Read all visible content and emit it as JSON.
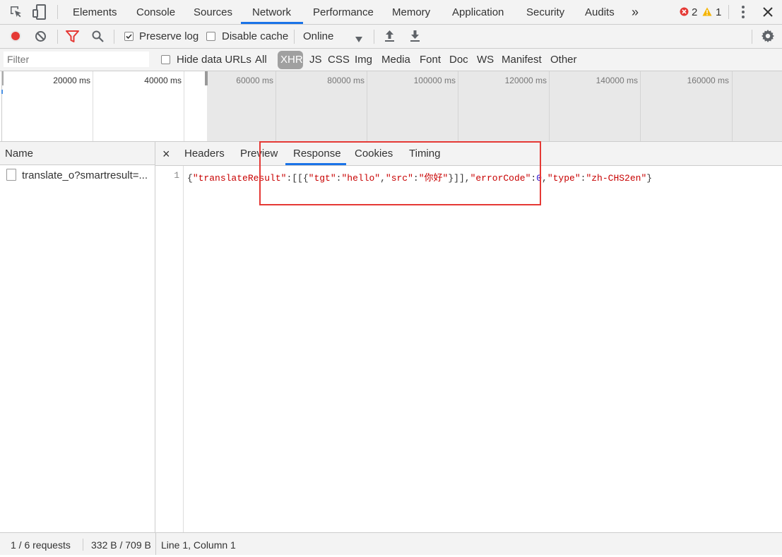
{
  "tabs": {
    "items": [
      "Elements",
      "Console",
      "Sources",
      "Network",
      "Performance",
      "Memory",
      "Application",
      "Security",
      "Audits"
    ],
    "active": "Network",
    "more": "»",
    "errors": "2",
    "warnings": "1"
  },
  "toolbar": {
    "preserve_log": "Preserve log",
    "preserve_log_checked": true,
    "disable_cache": "Disable cache",
    "disable_cache_checked": false,
    "throttle": "Online"
  },
  "filterbar": {
    "placeholder": "Filter",
    "hide_data_urls": "Hide data URLs",
    "types": [
      "All",
      "XHR",
      "JS",
      "CSS",
      "Img",
      "Media",
      "Font",
      "Doc",
      "WS",
      "Manifest",
      "Other"
    ],
    "active_type": "XHR"
  },
  "overview": {
    "ticks": [
      "20000 ms",
      "40000 ms",
      "60000 ms",
      "80000 ms",
      "100000 ms",
      "120000 ms",
      "140000 ms",
      "160000 ms"
    ]
  },
  "requests": {
    "header": "Name",
    "items": [
      "translate_o?smartresult=..."
    ]
  },
  "detail": {
    "close": "×",
    "tabs": [
      "Headers",
      "Preview",
      "Response",
      "Cookies",
      "Timing"
    ],
    "active": "Response"
  },
  "response": {
    "line_number": "1",
    "tokens": [
      {
        "t": "{",
        "c": "#333"
      },
      {
        "t": "\"translateResult\"",
        "c": "#c80000"
      },
      {
        "t": ":[[{",
        "c": "#333"
      },
      {
        "t": "\"tgt\"",
        "c": "#c80000"
      },
      {
        "t": ":",
        "c": "#333"
      },
      {
        "t": "\"hello\"",
        "c": "#c80000"
      },
      {
        "t": ",",
        "c": "#333"
      },
      {
        "t": "\"src\"",
        "c": "#c80000"
      },
      {
        "t": ":",
        "c": "#333"
      },
      {
        "t": "\"你好\"",
        "c": "#c80000"
      },
      {
        "t": "}]],",
        "c": "#333"
      },
      {
        "t": "\"errorCode\"",
        "c": "#c80000"
      },
      {
        "t": ":",
        "c": "#333"
      },
      {
        "t": "0",
        "c": "#1c00cf"
      },
      {
        "t": ",",
        "c": "#333"
      },
      {
        "t": "\"type\"",
        "c": "#c80000"
      },
      {
        "t": ":",
        "c": "#333"
      },
      {
        "t": "\"zh-CHS2en\"",
        "c": "#c80000"
      },
      {
        "t": "}",
        "c": "#333"
      }
    ]
  },
  "status": {
    "requests": "1 / 6 requests",
    "size": "332 B / 709 B",
    "cursor": "Line 1, Column 1"
  }
}
